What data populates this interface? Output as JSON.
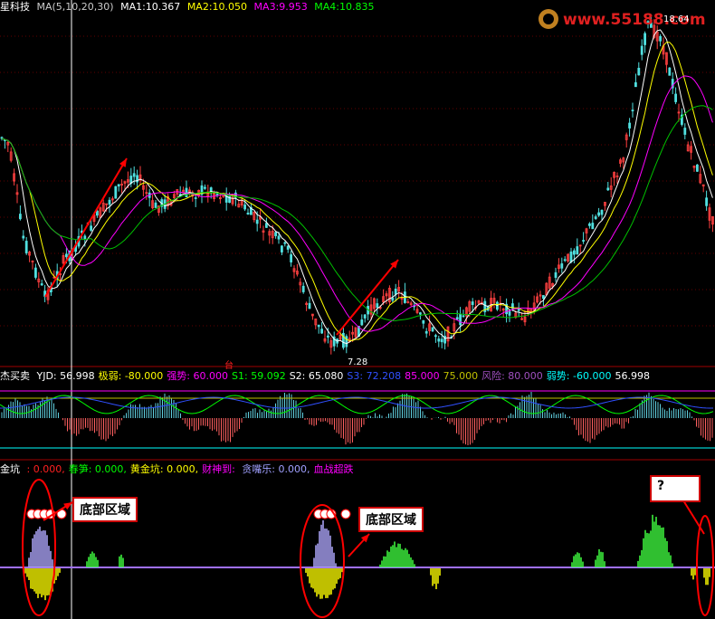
{
  "main_header": {
    "name": "星科技",
    "ma_params": "MA(5,10,20,30)",
    "ma1_label": "MA1:",
    "ma1": "10.367",
    "ma2_label": "MA2:",
    "ma2": "10.050",
    "ma3_label": "MA3:",
    "ma3": "9.953",
    "ma4_label": "MA4:",
    "ma4": "10.835",
    "high_mark": "18.64",
    "low_mark": "7.28",
    "date_mark": "台"
  },
  "logo": {
    "text": "www.55188.com"
  },
  "yjd_header": {
    "name": "杰买卖",
    "items": [
      {
        "label": "YJD:",
        "value": "56.998",
        "color": "#ffffff"
      },
      {
        "label": "极弱:",
        "value": "-80.000",
        "color": "#ffff00"
      },
      {
        "label": "强势:",
        "value": "60.000",
        "color": "#ff00ff"
      },
      {
        "label": "S1:",
        "value": "59.092",
        "color": "#00ff00"
      },
      {
        "label": "S2:",
        "value": "65.080",
        "color": "#ffffff"
      },
      {
        "label": "S3:",
        "value": "72.208",
        "color": "#3050ff"
      },
      {
        "label": "",
        "value": "85.000",
        "color": "#ff00ff"
      },
      {
        "label": "",
        "value": "75.000",
        "color": "#c0c000"
      },
      {
        "label": "风险:",
        "value": "80.000",
        "color": "#a050c0"
      },
      {
        "label": "弱势:",
        "value": "-60.000",
        "color": "#00ffff"
      },
      {
        "label": "",
        "value": "56.998",
        "color": "#ffffff"
      }
    ]
  },
  "jinkeng_header": {
    "name": "金坑",
    "items": [
      {
        "label": "",
        "value": ": 0.000,",
        "color": "#ff2020"
      },
      {
        "label": "春笋:",
        "value": "0.000,",
        "color": "#00ff00"
      },
      {
        "label": "黄金坑:",
        "value": "0.000,",
        "color": "#ffff00"
      },
      {
        "label": "财神到:",
        "value": "",
        "color": "#ff00ff"
      },
      {
        "label": "贪嘴乐:",
        "value": "0.000,",
        "color": "#a0a0ff"
      },
      {
        "label": "血战超跌",
        "value": "",
        "color": "#ff00ff"
      }
    ]
  },
  "callouts": {
    "bottom_zone_1": "底部区域",
    "bottom_zone_2": "底部区域",
    "question": "?"
  },
  "colors": {
    "up": "#ff4040",
    "down": "#50e0e0",
    "ma1": "#ffffff",
    "ma2": "#ffff00",
    "ma3": "#ff00ff",
    "ma4": "#00c000",
    "annotation": "#ff0000"
  },
  "chart_data": {
    "type": "candlestick",
    "title": "",
    "max_label": "18.64",
    "min_label": "7.28"
  }
}
